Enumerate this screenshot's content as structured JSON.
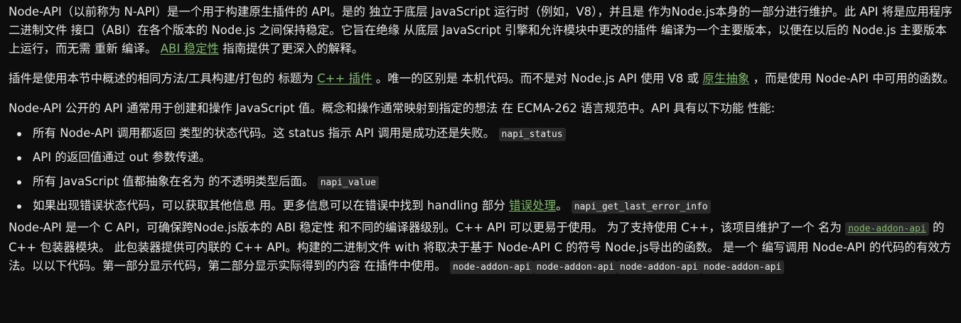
{
  "p1": {
    "t1": "Node-API（以前称为 N-API）是一个用于构建原生插件的 API。是的 独立于底层 JavaScript 运行时（例如，V8），并且是 作为Node.js本身的一部分进行维护。此 API 将是应用程序二进制文件 接口（ABI）在各个版本的 Node.js 之间保持稳定。它旨在绝缘 从底层 JavaScript 引擎和允许模块中更改的插件 编译为一个主要版本，以便在以后的 Node.js 主要版本上运行，而无需 重新 编译。",
    "link": "ABI 稳定性",
    "t2": "指南提供了更深入的解释。"
  },
  "p2": {
    "t1": "插件是使用本节中概述的相同方法/工具构建/打包的 标题为",
    "link1": "C++ 插件",
    "t2": "。唯一的区别是 本机代码。而不是对 Node.js API 使用 V8 或",
    "link2": "原生抽象",
    "t3": "，而是使用 Node-API 中可用的函数。"
  },
  "p3": "Node-API 公开的 API 通常用于创建和操作 JavaScript 值。概念和操作通常映射到指定的想法 在 ECMA-262 语言规范中。API 具有以下功能 性能:",
  "list": [
    {
      "text": "所有 Node-API 调用都返回 类型的状态代码。这 status 指示 API 调用是成功还是失败。",
      "code": "napi_status"
    },
    {
      "text": "API 的返回值通过 out 参数传递。"
    },
    {
      "text": "所有 JavaScript 值都抽象在名为 的不透明类型后面。",
      "code": "napi_value"
    },
    {
      "text": "如果出现错误状态代码，可以获取其他信息 用。更多信息可以在错误中找到 handling 部分",
      "link": "错误处理",
      "after": "。",
      "code": "napi_get_last_error_info"
    }
  ],
  "p4": {
    "t1": "Node-API 是一个 C API，可确保跨Node.js版本的 ABI 稳定性 和不同的编译器级别。C++ API 可以更易于使用。 为了支持使用 C++，该项目维护了一个 名为",
    "code_link": "node-addon-api",
    "t2": "的 C++ 包装器模块。 此包装器提供可内联的 C++ API。构建的二进制文件 with 将取决于基于 Node-API C 的符号 Node.js导出的函数。 是一个 编写调用 Node-API 的代码的有效方法。以以下代码。第一部分显示代码，第二部分显示实际得到的内容 在插件中使用。",
    "codes": [
      "node-addon-api",
      "node-addon-api",
      "node-addon-api",
      "node-addon-api"
    ]
  }
}
